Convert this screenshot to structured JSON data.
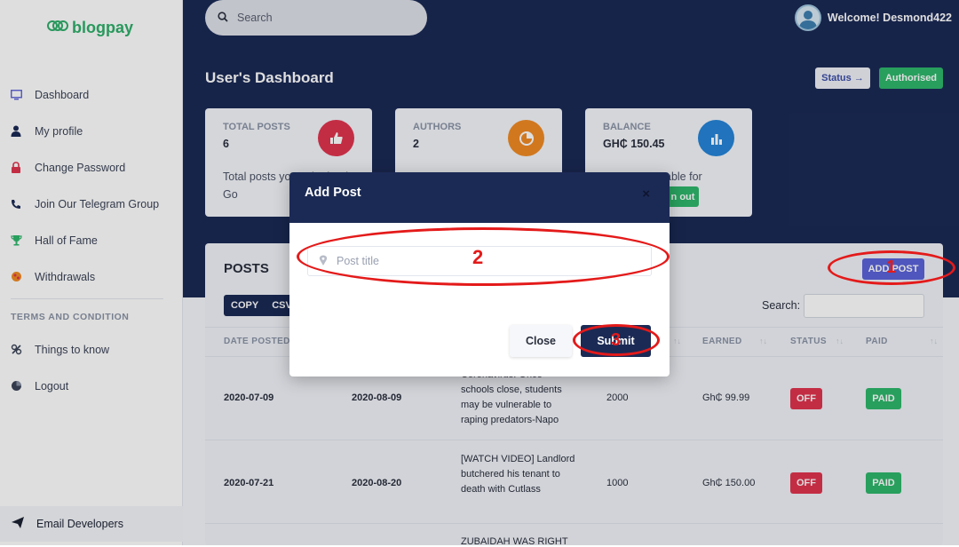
{
  "app": {
    "logo_text": "blogpay"
  },
  "sidebar": {
    "items": [
      {
        "label": "Dashboard",
        "icon": "monitor-icon"
      },
      {
        "label": "My profile",
        "icon": "user-icon"
      },
      {
        "label": "Change Password",
        "icon": "lock-icon"
      },
      {
        "label": "Join Our Telegram Group",
        "icon": "phone-icon"
      },
      {
        "label": "Hall of Fame",
        "icon": "trophy-icon"
      },
      {
        "label": "Withdrawals",
        "icon": "money-icon"
      }
    ],
    "section_title": "TERMS AND CONDITION",
    "items2": [
      {
        "label": "Things to know",
        "icon": "info-icon"
      },
      {
        "label": "Logout",
        "icon": "logout-icon"
      }
    ],
    "footer_label": "Email Developers"
  },
  "header": {
    "search_placeholder": "Search",
    "welcome": "Welcome! Desmond422"
  },
  "page": {
    "title": "User's Dashboard",
    "status_button": "Status →",
    "authorised_button": "Authorised"
  },
  "cards": [
    {
      "title": "TOTAL POSTS",
      "value": "6",
      "text": "Total posts you submitted. Go",
      "color": "#e0344f"
    },
    {
      "title": "AUTHORS",
      "value": "2",
      "text": "",
      "color": "#f08a24"
    },
    {
      "title": "BALANCE",
      "value": "GH₵ 150.45",
      "text": "able for",
      "button": "n out",
      "color": "#2585d8"
    }
  ],
  "posts": {
    "title": "POSTS",
    "add_button": "ADD POST",
    "copy_label": "COPY",
    "csv_label": "CSV",
    "search_label": "Search:",
    "columns": [
      "DATE POSTED",
      "EARNED",
      "STATUS",
      "PAID"
    ],
    "rows": [
      {
        "date_posted": "2020-07-09",
        "date_paid": "2020-08-09",
        "title": "Coronavirus: Once schools close, students may be vulnerable to raping predators-Napo",
        "words": "2000",
        "earned": "Gh₵ 99.99",
        "status": "OFF",
        "paid": "PAID"
      },
      {
        "date_posted": "2020-07-21",
        "date_paid": "2020-08-20",
        "title": "[WATCH VIDEO] Landlord butchered his tenant to death with Cutlass",
        "words": "1000",
        "earned": "Gh₵ 150.00",
        "status": "OFF",
        "paid": "PAID"
      },
      {
        "title": "ZUBAIDAH WAS RIGHT"
      }
    ]
  },
  "modal": {
    "title": "Add Post",
    "close_x": "×",
    "input_placeholder": "Post title",
    "close_button": "Close",
    "submit_button": "Submit"
  },
  "annotations": {
    "a1": "1",
    "a2": "2",
    "a3": "3"
  },
  "colors": {
    "navy": "#1b2a55",
    "green": "#2fb76b",
    "red": "#e0344f",
    "indigo": "#5b63d9",
    "annotation": "#e41a1a"
  }
}
